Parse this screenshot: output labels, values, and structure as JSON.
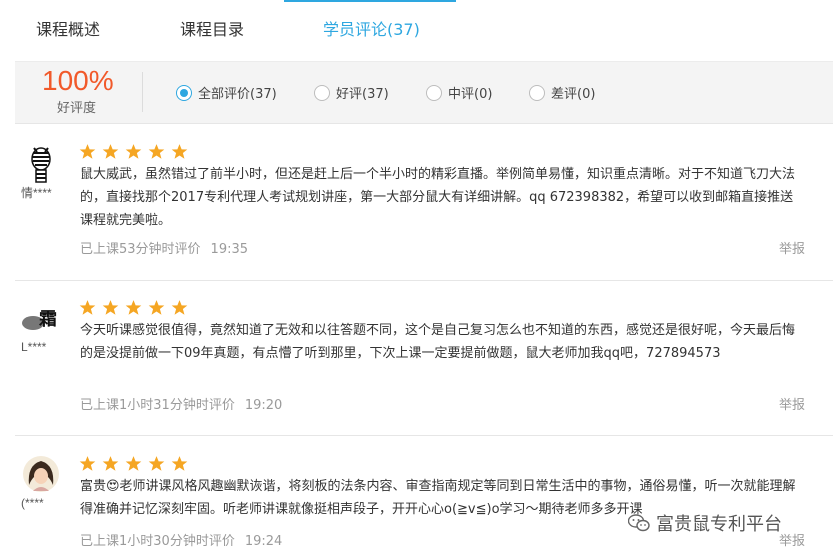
{
  "tabs": [
    {
      "label": "课程概述"
    },
    {
      "label": "课程目录"
    },
    {
      "label": "学员评论(37)"
    }
  ],
  "accent_color": "#2ea7e0",
  "summary": {
    "percent": "100%",
    "percent_label": "好评度",
    "percent_color": "#f1592a",
    "filters": [
      {
        "label": "全部评价(37)",
        "selected": true
      },
      {
        "label": "好评(37)",
        "selected": false
      },
      {
        "label": "中评(0)",
        "selected": false
      },
      {
        "label": "差评(0)",
        "selected": false
      }
    ]
  },
  "reviews": [
    {
      "username": "情****",
      "avatar_icon": "zebra-avatar-icon",
      "rating": 5,
      "text": "鼠大威武，虽然错过了前半小时，但还是赶上后一个半小时的精彩直播。举例简单易懂，知识重点清晰。对于不知道飞刀大法的，直接找那个2017专利代理人考试规划讲座，第一大部分鼠大有详细讲解。qq 672398382，希望可以收到邮箱直接推送课程就完美啦。",
      "meta": "已上课53分钟时评价",
      "time": "19:35",
      "report_label": "举报"
    },
    {
      "username": "L****",
      "avatar_icon": "calligraphy-avatar-icon",
      "rating": 5,
      "text": "今天听课感觉很值得，竟然知道了无效和以往答题不同，这个是自己复习怎么也不知道的东西，感觉还是很好呢，今天最后悔的是没提前做一下09年真题，有点懵了听到那里，下次上课一定要提前做题，鼠大老师加我qq吧，727894573",
      "meta": "已上课1小时31分钟时评价",
      "time": "19:20",
      "report_label": "举报"
    },
    {
      "username": "(****",
      "avatar_icon": "girl-avatar-icon",
      "rating": 5,
      "text": "富贵😍老师讲课风格风趣幽默诙谐，将刻板的法条内容、审查指南规定等同到日常生活中的事物，通俗易懂，听一次就能理解得准确并记忆深刻牢固。听老师讲课就像挺相声段子，开开心心o(≧v≦)o学习～期待老师多多开课",
      "meta": "已上课1小时30分钟时评价",
      "time": "19:24",
      "report_label": "举报"
    }
  ],
  "watermark": {
    "text": "富贵鼠专利平台",
    "icon": "wechat-icon"
  }
}
